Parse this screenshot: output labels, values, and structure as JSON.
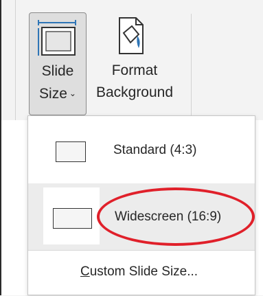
{
  "ribbon": {
    "slide_size": {
      "line1": "Slide",
      "line2": "Size",
      "chevron": "⌄",
      "icon": "slide-size-icon"
    },
    "format_background": {
      "line1": "Format",
      "line2": "Background",
      "icon": "format-background-icon"
    }
  },
  "dropdown": {
    "items": [
      {
        "label": "Standard (4:3)",
        "thumbnail": "standard-slide-thumbnail"
      },
      {
        "label": "Widescreen (16:9)",
        "thumbnail": "widescreen-slide-thumbnail",
        "highlighted": true,
        "annotation": "red-ellipse"
      }
    ],
    "custom": {
      "mnemonic": "C",
      "rest": "ustom Slide Size..."
    }
  },
  "colors": {
    "ribbon_bg": "#f3f3f3",
    "button_pressed": "#dedede",
    "hover_row": "#ececec",
    "annotation_red": "#e0202a",
    "icon_blue": "#2e75b6"
  }
}
